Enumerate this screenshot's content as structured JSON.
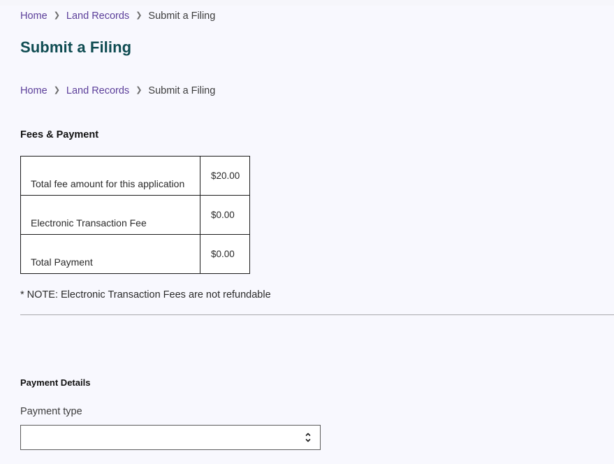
{
  "breadcrumb": {
    "items": [
      {
        "label": "Home"
      },
      {
        "label": "Land Records"
      },
      {
        "label": "Submit a Filing"
      }
    ]
  },
  "header": {
    "title": "Submit a Filing"
  },
  "fees": {
    "heading": "Fees & Payment",
    "rows": [
      {
        "label": "Total fee amount for this application",
        "value": "$20.00"
      },
      {
        "label": "Electronic Transaction Fee",
        "value": "$0.00"
      },
      {
        "label": "Total Payment",
        "value": "$0.00"
      }
    ],
    "note": "* NOTE: Electronic Transaction Fees are not refundable"
  },
  "payment": {
    "heading": "Payment Details",
    "type_label": "Payment type",
    "type_value": ""
  },
  "colors": {
    "title": "#0f4c52",
    "link": "#5c3f9a",
    "background": "#f8f8fe"
  }
}
